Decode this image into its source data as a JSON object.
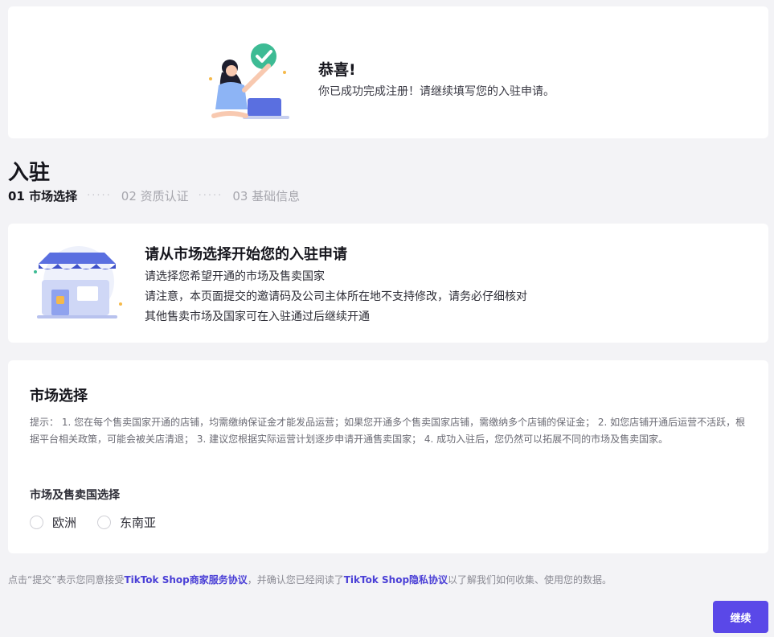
{
  "congrats": {
    "title": "恭喜!",
    "message": "你已成功完成注册！请继续填写您的入驻申请。"
  },
  "page": {
    "title": "入驻"
  },
  "steps": [
    {
      "label": "01 市场选择",
      "active": true
    },
    {
      "label": "02 资质认证",
      "active": false
    },
    {
      "label": "03 基础信息",
      "active": false
    }
  ],
  "info": {
    "title": "请从市场选择开始您的入驻申请",
    "line1": "请选择您希望开通的市场及售卖国家",
    "line2": "请注意，本页面提交的邀请码及公司主体所在地不支持修改，请务必仔细核对",
    "line3": "其他售卖市场及国家可在入驻通过后继续开通"
  },
  "market": {
    "title": "市场选择",
    "tips": "提示：  1. 您在每个售卖国家开通的店铺，均需缴纳保证金才能发品运营；如果您开通多个售卖国家店铺，需缴纳多个店铺的保证金；  2. 如您店铺开通后运营不活跃，根据平台相关政策，可能会被关店清退；  3. 建议您根据实际运营计划逐步申请开通售卖国家；  4. 成功入驻后，您仍然可以拓展不同的市场及售卖国家。",
    "subtitle": "市场及售卖国选择",
    "options": [
      "欧洲",
      "东南亚"
    ]
  },
  "agreement": {
    "prefix": "点击“提交”表示您同意接受",
    "link1": "TikTok Shop商家服务协议",
    "middle": "，并确认您已经阅读了",
    "link2": "TikTok Shop隐私协议",
    "suffix": "以了解我们如何收集、使用您的数据。"
  },
  "actions": {
    "continue_label": "继续"
  },
  "colors": {
    "accent": "#5a48e8",
    "link": "#4a3fd6",
    "check_green": "#3dbb94",
    "background": "#f3f3f6"
  }
}
